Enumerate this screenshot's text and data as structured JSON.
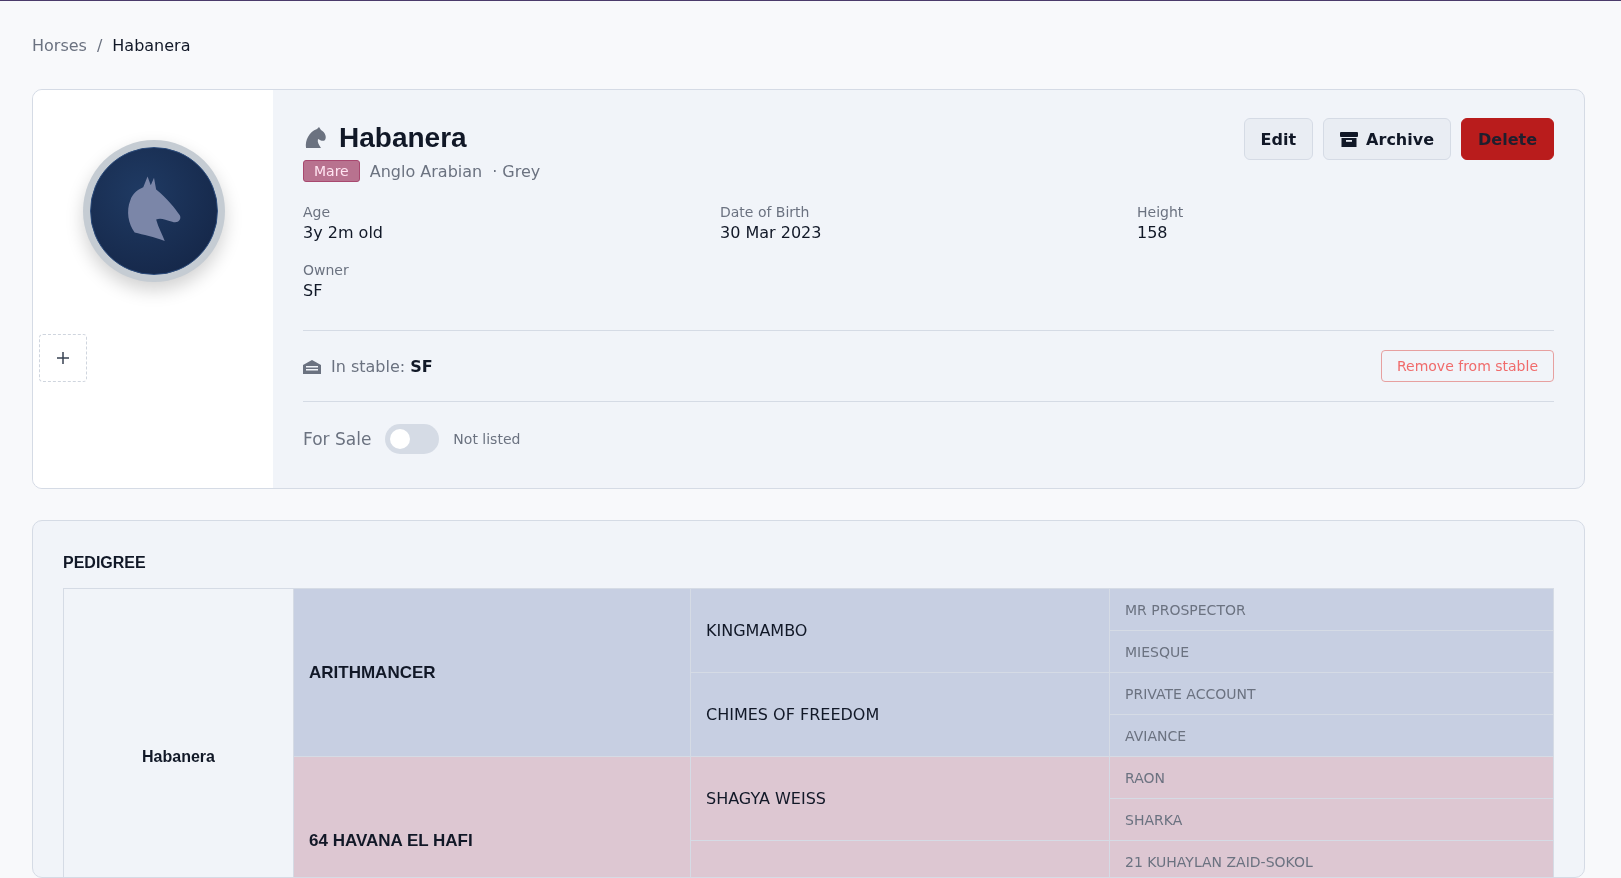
{
  "breadcrumb": [
    {
      "label": "Horses",
      "current": false
    },
    {
      "label": "Habanera",
      "current": true
    }
  ],
  "breadcrumb_separator": "/",
  "horse": {
    "name": "Habanera",
    "sex": "Mare",
    "breed": "Anglo Arabian",
    "coat": "· Grey"
  },
  "actions": [
    {
      "label": "Edit",
      "kind": "plain"
    },
    {
      "label": "Archive",
      "kind": "archive"
    },
    {
      "label": "Delete",
      "kind": "danger"
    }
  ],
  "details": [
    {
      "label": "Age",
      "value": "3y 2m old"
    },
    {
      "label": "Date of Birth",
      "value": "30 Mar 2023"
    },
    {
      "label": "Height",
      "value": "158"
    },
    {
      "label": "Owner",
      "value": "SF"
    }
  ],
  "stable": {
    "text": "In stable: **SF**",
    "button": "Remove from stable"
  },
  "for_sale": {
    "label": "For Sale",
    "on": false,
    "status": "Not listed"
  },
  "pedigree": {
    "title": "PEDIGREE",
    "subject": {
      "name": "Habanera",
      "children": [
        {
          "name": "ARITHMANCER",
          "color": "#c7cfe2",
          "children": [
            {
              "name": "KINGMAMBO",
              "children": [
                {
                  "name": "MR PROSPECTOR"
                },
                {
                  "name": "MIESQUE"
                }
              ]
            },
            {
              "name": "CHIMES OF FREEDOM",
              "children": [
                {
                  "name": "PRIVATE ACCOUNT"
                },
                {
                  "name": "AVIANCE"
                }
              ]
            }
          ]
        },
        {
          "name": "64 HAVANA EL HAFI",
          "color": "#ddc7d2",
          "children": [
            {
              "name": "SHAGYA WEISS",
              "children": [
                {
                  "name": "RAON"
                },
                {
                  "name": "SHARKA"
                }
              ]
            },
            {
              "children": [
                {
                  "name": "21 KUHAYLAN ZAID-SOKOL"
                }
              ]
            }
          ]
        }
      ]
    }
  }
}
